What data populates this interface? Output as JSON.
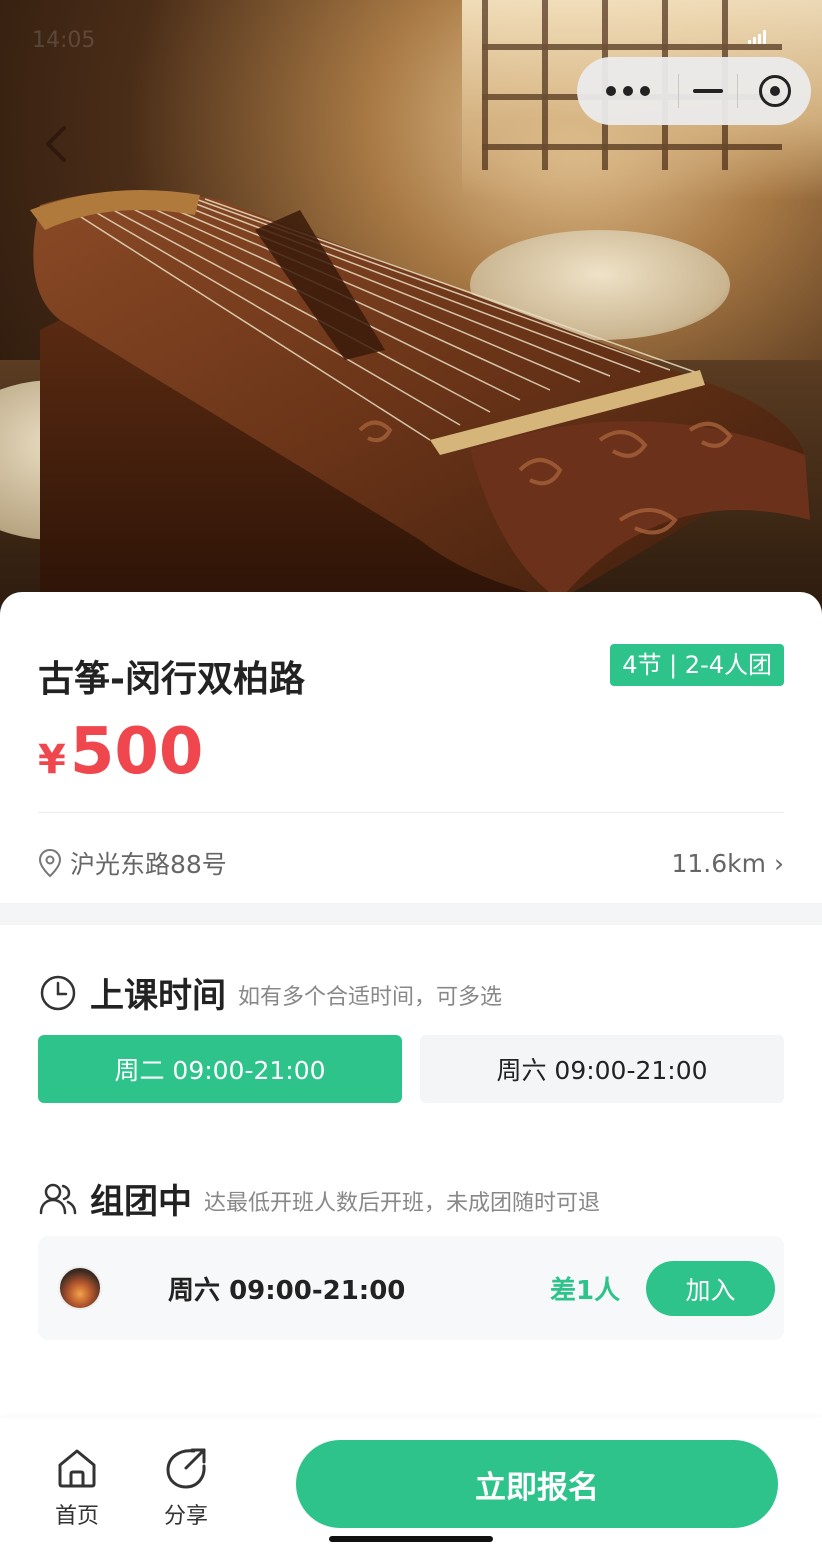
{
  "status": {
    "time": "14:05"
  },
  "course": {
    "title": "古筝-闵行双柏路",
    "tag": "4节 | 2-4人团",
    "currency": "¥",
    "price": "500",
    "address": "沪光东路88号",
    "distance": "11.6km",
    "distance_arrow": "›"
  },
  "schedule": {
    "title": "上课时间",
    "subtitle": "如有多个合适时间，可多选",
    "options": [
      {
        "label": "周二 09:00-21:00",
        "selected": true
      },
      {
        "label": "周六 09:00-21:00",
        "selected": false
      }
    ]
  },
  "groups": {
    "title": "组团中",
    "subtitle": "达最低开班人数后开班，未成团随时可退",
    "items": [
      {
        "day": "周六",
        "time": "09:00-21:00",
        "remaining": "差1人",
        "join_label": "加入"
      }
    ]
  },
  "bottom_nav": {
    "home_label": "首页",
    "share_label": "分享",
    "signup_label": "立即报名"
  },
  "colors": {
    "accent": "#2fc38c",
    "price": "#f0474e"
  }
}
